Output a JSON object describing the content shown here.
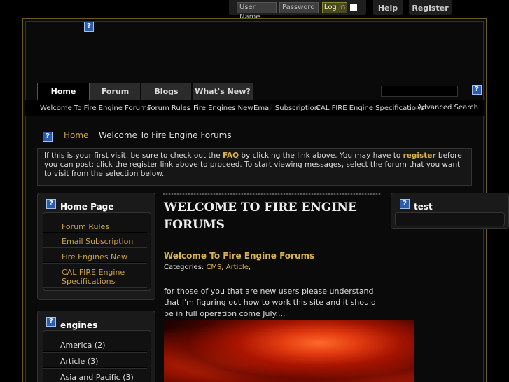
{
  "login": {
    "username_placeholder": "User Name",
    "password_placeholder": "Password",
    "login_button": "Log in"
  },
  "top_buttons": {
    "help": "Help",
    "register": "Register"
  },
  "nav": {
    "tabs": [
      "Home",
      "Forum",
      "Blogs",
      "What's New?"
    ],
    "sub": [
      "Welcome To Fire Engine Forums",
      "Forum Rules",
      "Fire Engines New",
      "Email Subscription",
      "CAL FIRE Engine Specifications"
    ],
    "advanced_search": "Advanced Search"
  },
  "breadcrumb": {
    "home": "Home",
    "current": "Welcome To Fire Engine Forums"
  },
  "notice": {
    "part1": "If this is your first visit, be sure to check out the ",
    "faq": "FAQ",
    "part2": " by clicking the link above. You may have to ",
    "register": "register",
    "part3": " before you can post: click the register link above to proceed. To start viewing messages, select the forum that you want to visit from the selection below."
  },
  "left": {
    "homepage_title": "Home Page",
    "homepage_links": [
      "Forum Rules",
      "Email Subscription",
      "Fire Engines New",
      "CAL FIRE Engine Specifications"
    ],
    "engines_title": "engines",
    "engines_categories": [
      "America (2)",
      "Article (3)",
      "Asia and Pacific (3)"
    ]
  },
  "center": {
    "title": "WELCOME TO FIRE ENGINE FORUMS",
    "article_title": "Welcome To Fire Engine Forums",
    "categories_label": "Categories: ",
    "categories": [
      "CMS",
      "Article"
    ],
    "body": "for those of you that are new users please understand that I'm figuring out how to work this site and it should be in full operation come July...."
  },
  "right": {
    "test_title": "test"
  }
}
